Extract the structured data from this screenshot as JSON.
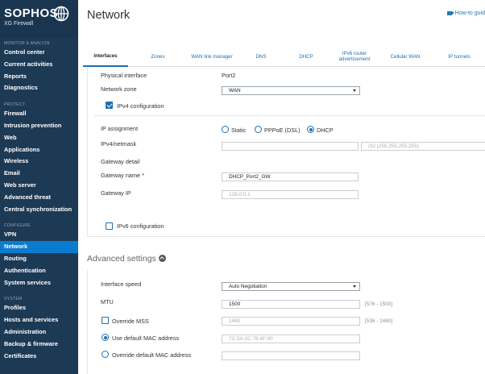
{
  "brand": {
    "name": "SOPHOS",
    "product": "XG Firewall"
  },
  "sidebar": {
    "sections": [
      {
        "title": "MONITOR & ANALYZE",
        "items": [
          "Control center",
          "Current activities",
          "Reports",
          "Diagnostics"
        ]
      },
      {
        "title": "PROTECT",
        "items": [
          "Firewall",
          "Intrusion prevention",
          "Web",
          "Applications",
          "Wireless",
          "Email",
          "Web server",
          "Advanced threat",
          "Central synchronization"
        ]
      },
      {
        "title": "CONFIGURE",
        "items": [
          "VPN",
          "Network",
          "Routing",
          "Authentication",
          "System services"
        ]
      },
      {
        "title": "SYSTEM",
        "items": [
          "Profiles",
          "Hosts and services",
          "Administration",
          "Backup & firmware",
          "Certificates"
        ]
      }
    ],
    "active": "Network"
  },
  "header": {
    "title": "Network",
    "help_link": "How-to guid"
  },
  "tabs": [
    "Interfaces",
    "Zones",
    "WAN link manager",
    "DNS",
    "DHCP",
    "IPv6 router advertisement",
    "Cellular WAN",
    "IP tunnels"
  ],
  "active_tab": "Interfaces",
  "form": {
    "physical_interface": {
      "label": "Physical interface",
      "value": "Port2"
    },
    "network_zone": {
      "label": "Network zone",
      "value": "WAN"
    },
    "ipv4_config": {
      "label": "IPv4 configuration",
      "checked": true
    },
    "ip_assignment": {
      "label": "IP assignment",
      "options": [
        "Static",
        "PPPoE (DSL)",
        "DHCP"
      ],
      "selected": "DHCP"
    },
    "ipv4_netmask": {
      "label": "IPv4/netmask",
      "value": "",
      "netmask": "/32 (255.255.255.255)"
    },
    "gateway_detail": {
      "label": "Gateway detail"
    },
    "gateway_name": {
      "label": "Gateway name *",
      "value": "DHCP_Port2_GW"
    },
    "gateway_ip": {
      "label": "Gateway IP",
      "placeholder": "128.0.0.1"
    },
    "ipv6_config": {
      "label": "IPv6 configuration",
      "checked": false
    }
  },
  "advanced": {
    "title": "Advanced settings",
    "interface_speed": {
      "label": "Interface speed",
      "value": "Auto Negotiation"
    },
    "mtu": {
      "label": "MTU",
      "value": "1500",
      "hint": "[576 - 1500]"
    },
    "override_mss": {
      "label": "Override MSS",
      "checked": false,
      "placeholder": "1460",
      "hint": "[536 - 1460]"
    },
    "default_mac": {
      "label": "Use default MAC address",
      "selected": true,
      "placeholder": "7C:5A:1C:78:4F:00"
    },
    "override_mac": {
      "label": "Override default MAC address",
      "selected": false,
      "value": ""
    }
  },
  "colors": {
    "sidebar_bg": "#1d3a55",
    "active_item": "#0a7ccf",
    "accent": "#1f6fb0"
  }
}
